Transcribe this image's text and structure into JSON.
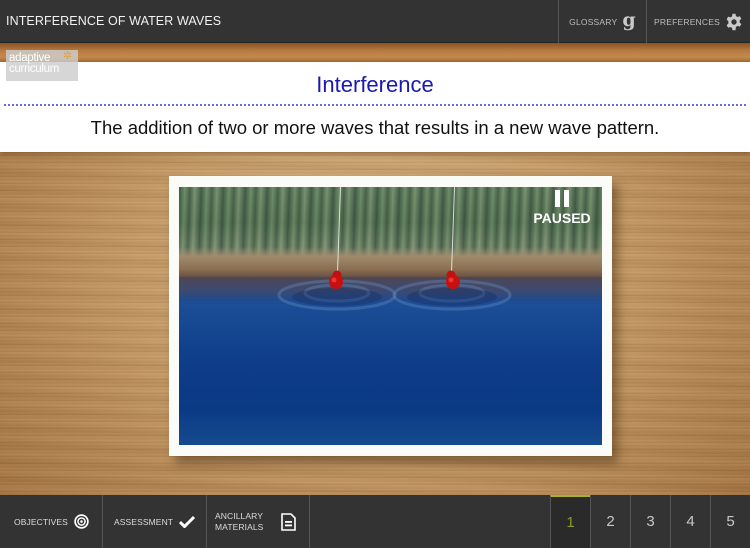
{
  "topbar": {
    "title": "INTERFERENCE OF WATER WAVES",
    "glossary_label": "GLOSSARY",
    "glossary_icon": "g",
    "preferences_label": "PREFERENCES"
  },
  "logo": {
    "line1": "adaptive",
    "line2": "curriculum"
  },
  "card": {
    "title": "Interference",
    "definition": "The addition of two or more waves that results in a new wave pattern."
  },
  "simulation": {
    "status": "PAUSED",
    "sources": 2
  },
  "bottombar": {
    "objectives_label": "OBJECTIVES",
    "assessment_label": "ASSESSMENT",
    "ancillary_line1": "ANCILLARY",
    "ancillary_line2": "MATERIALS",
    "pages": [
      "1",
      "2",
      "3",
      "4",
      "5"
    ],
    "active_page": "1"
  },
  "colors": {
    "title_blue": "#1a1ab0",
    "active_page": "#a8b02e",
    "bar_bg": "#333333"
  }
}
